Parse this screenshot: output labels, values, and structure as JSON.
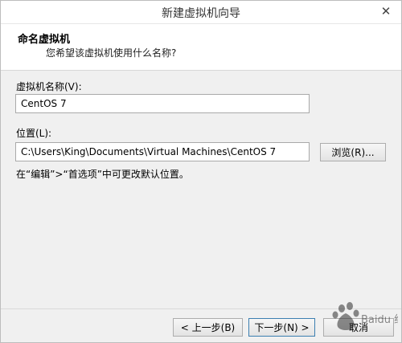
{
  "window": {
    "title": "新建虚拟机向导",
    "close_glyph": "✕"
  },
  "header": {
    "title": "命名虚拟机",
    "subtitle": "您希望该虚拟机使用什么名称?"
  },
  "form": {
    "name_label": "虚拟机名称(V):",
    "name_value": "CentOS 7",
    "location_label": "位置(L):",
    "location_value": "C:\\Users\\King\\Documents\\Virtual Machines\\CentOS 7",
    "browse_label": "浏览(R)...",
    "hint": "在“编辑”>“首选项”中可更改默认位置。"
  },
  "footer": {
    "back_label": "< 上一步(B)",
    "next_label": "下一步(N) >",
    "cancel_label": "取消"
  },
  "watermark": {
    "text": "Baidu 经验",
    "color": "#2e2e2e"
  }
}
